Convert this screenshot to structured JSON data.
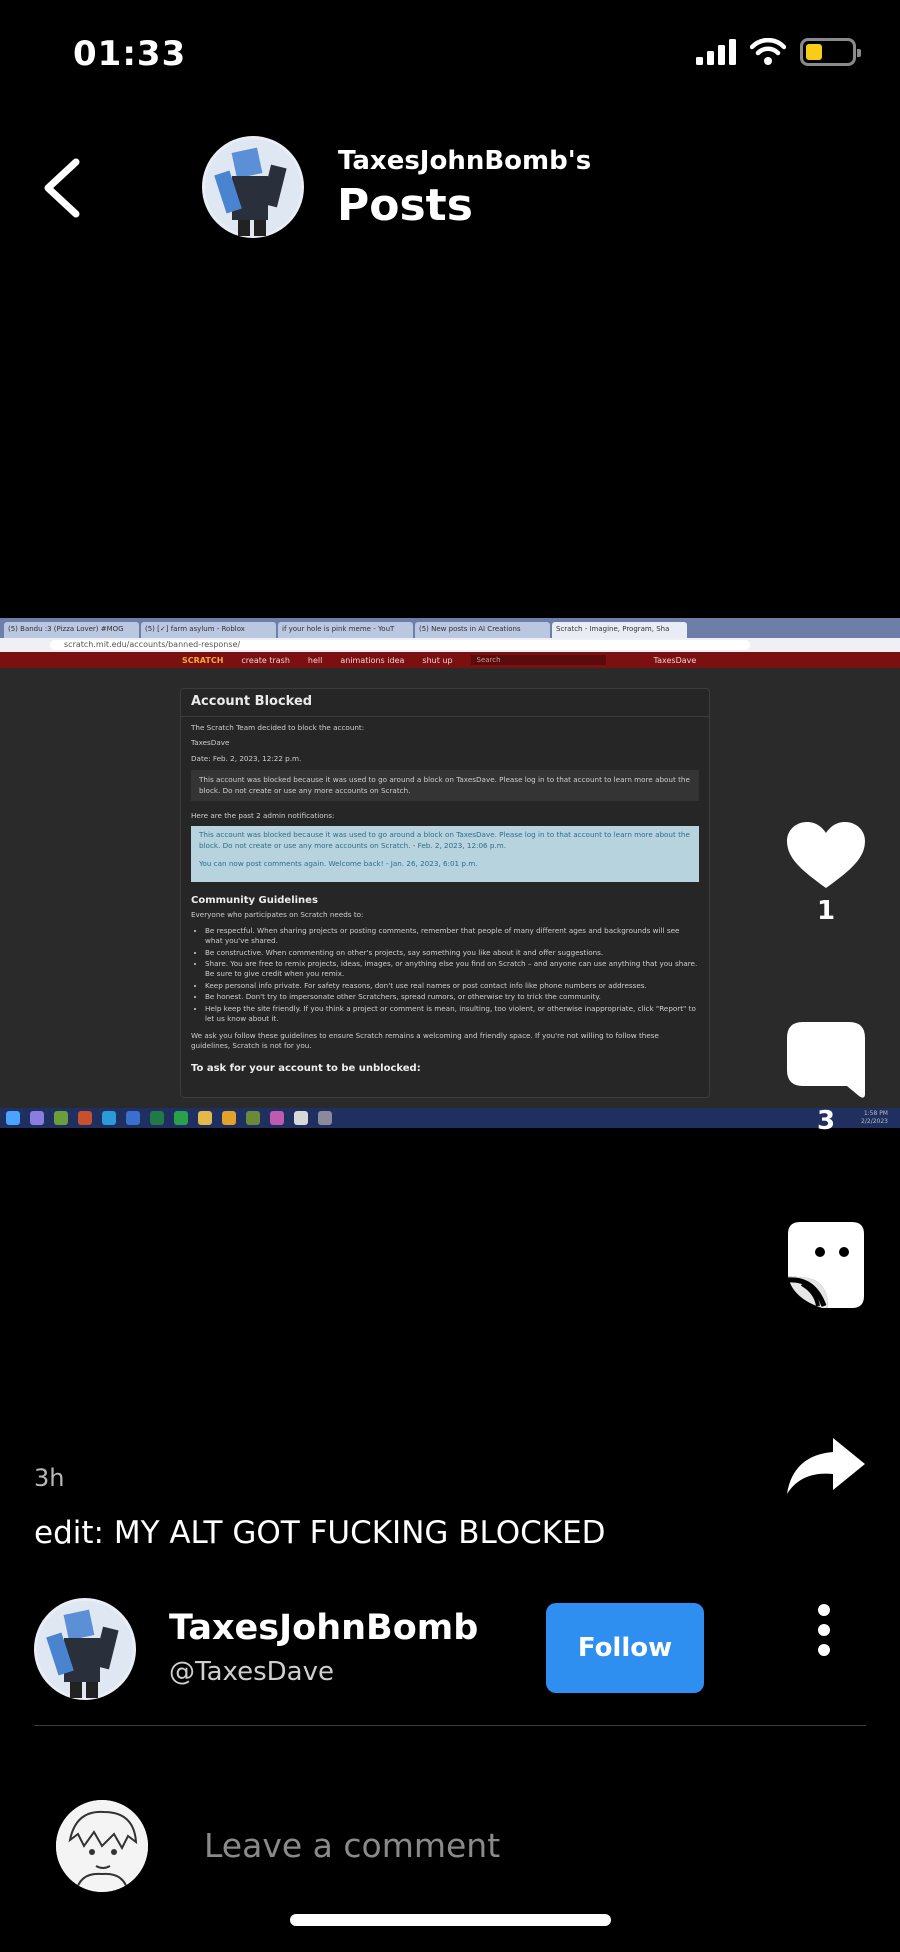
{
  "status_bar": {
    "time": "01:33",
    "battery_color": "#f7cd17"
  },
  "header": {
    "owner": "TaxesJohnBomb's",
    "title": "Posts"
  },
  "media": {
    "tabs": [
      "(5) Bandu :3 (Pizza Lover) #MOG",
      "(5) [✓] farm asylum - Roblox",
      "if your hole is pink meme - YouT",
      "(5) New posts in AI Creations",
      "Scratch - Imagine, Program, Sha"
    ],
    "url": "scratch.mit.edu/accounts/banned-response/",
    "nav": {
      "logo": "SCRATCH",
      "items": [
        "create trash",
        "hell",
        "animations idea",
        "shut up"
      ],
      "search": "Search",
      "user": "TaxesDave"
    },
    "panel": {
      "title": "Account Blocked",
      "intro": "The Scratch Team decided to block the account:",
      "account": "TaxesDave",
      "date": "Date: Feb. 2, 2023, 12:22 p.m.",
      "reason": "This account was blocked because it was used to go around a block on TaxesDave. Please log in to that account to learn more about the block. Do not create or use any more accounts on Scratch.",
      "past_label": "Here are the past 2 admin notifications:",
      "notification_1": "This account was blocked because it was used to go around a block on TaxesDave. Please log in to that account to learn more about the block. Do not create or use any more accounts on Scratch. - Feb. 2, 2023, 12:06 p.m.",
      "notification_2": "You can now post comments again. Welcome back! - Jan. 26, 2023, 6:01 p.m.",
      "guidelines_title": "Community Guidelines",
      "guidelines_intro": "Everyone who participates on Scratch needs to:",
      "guidelines": [
        "Be respectful. When sharing projects or posting comments, remember that people of many different ages and backgrounds will see what you've shared.",
        "Be constructive. When commenting on other's projects, say something you like about it and offer suggestions.",
        "Share. You are free to remix projects, ideas, images, or anything else you find on Scratch – and anyone can use anything that you share. Be sure to give credit when you remix.",
        "Keep personal info private. For safety reasons, don't use real names or post contact info like phone numbers or addresses.",
        "Be honest. Don't try to impersonate other Scratchers, spread rumors, or otherwise try to trick the community.",
        "Help keep the site friendly. If you think a project or comment is mean, insulting, too violent, or otherwise inappropriate, click \"Report\" to let us know about it."
      ],
      "closing": "We ask you follow these guidelines to ensure Scratch remains a welcoming and friendly space. If you're not willing to follow these guidelines, Scratch is not for you.",
      "unblock_title": "To ask for your account to be unblocked:"
    },
    "taskbar_clock": [
      "1:58 PM",
      "2/2/2023"
    ]
  },
  "actions": {
    "likes": "1",
    "comments": "3"
  },
  "post": {
    "time": "3h",
    "caption": "edit: MY ALT GOT FUCKING BLOCKED"
  },
  "author": {
    "name": "TaxesJohnBomb",
    "handle": "@TaxesDave",
    "follow_label": "Follow",
    "follow_color": "#2f8ff0"
  },
  "comment": {
    "placeholder": "Leave a comment"
  }
}
